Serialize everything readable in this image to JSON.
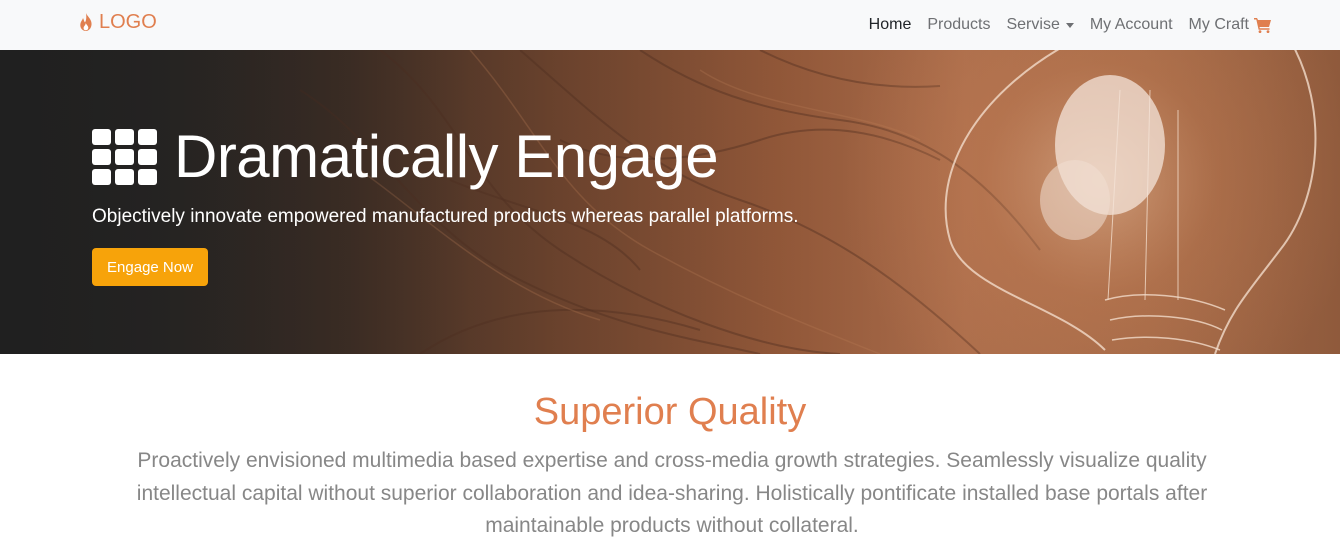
{
  "navbar": {
    "brand_text": "LOGO",
    "brand_icon": "flame-icon",
    "links": [
      {
        "label": "Home",
        "active": true
      },
      {
        "label": "Products"
      },
      {
        "label": "Servise",
        "icon": "caret-down-icon"
      },
      {
        "label": "My Account"
      },
      {
        "label": "My Craft",
        "icon": "shopping-cart-icon"
      }
    ]
  },
  "hero": {
    "icon": "grid-icon",
    "title": "Dramatically Engage",
    "subtitle": "Objectively innovate empowered manufactured products whereas parallel platforms.",
    "cta_label": "Engage Now"
  },
  "section": {
    "title": "Superior Quality",
    "text": "Proactively envisioned multimedia based expertise and cross-media growth strategies. Seamlessly visualize quality intellectual capital without superior collaboration and idea-sharing. Holistically pontificate installed base portals after maintainable products without collateral."
  },
  "colors": {
    "accent": "#e07f4f",
    "cta": "#f7a30a",
    "navbar_bg": "#f8f9fa",
    "nav_text": "#6e7073",
    "body_text": "#878787"
  }
}
